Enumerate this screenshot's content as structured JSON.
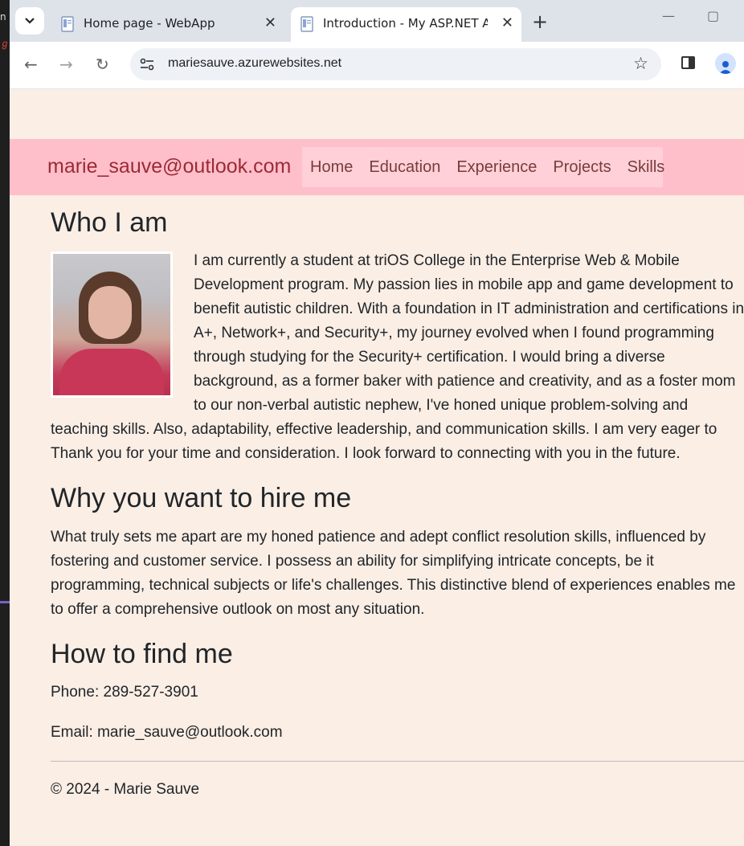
{
  "browser": {
    "tabs": [
      {
        "title": "Home page - WebApp",
        "active": false
      },
      {
        "title": "Introduction - My ASP.NET App",
        "active": true
      }
    ],
    "url": "mariesauve.azurewebsites.net"
  },
  "site": {
    "brand": "marie_sauve@outlook.com",
    "nav": [
      "Home",
      "Education",
      "Experience",
      "Projects",
      "Skills"
    ]
  },
  "content": {
    "who_heading": "Who I am",
    "who_text": "I am currently a student at triOS College in the Enterprise Web & Mobile Development program. My passion lies in mobile app and game development to benefit autistic children. With a foundation in IT administration and certifications in A+, Network+, and Security+, my journey evolved when I found programming through studying for the Security+ certification. I would bring a diverse background, as a former baker with patience and creativity, and as a foster mom to our non-verbal autistic nephew, I've honed unique problem-solving and teaching skills. Also, adaptability, effective leadership, and communication skills. I am very eager to Thank you for your time and consideration. I look forward to connecting with you in the future.",
    "why_heading": "Why you want to hire me",
    "why_text": "What truly sets me apart are my honed patience and adept conflict resolution skills, influenced by fostering and customer service. I possess an ability for simplifying intricate concepts, be it programming, technical subjects or life's challenges. This distinctive blend of experiences enables me to offer a comprehensive outlook on most any situation.",
    "find_heading": "How to find me",
    "phone": "Phone: 289-527-3901",
    "email": "Email: marie_sauve@outlook.com",
    "footer": "© 2024 - Marie Sauve"
  }
}
